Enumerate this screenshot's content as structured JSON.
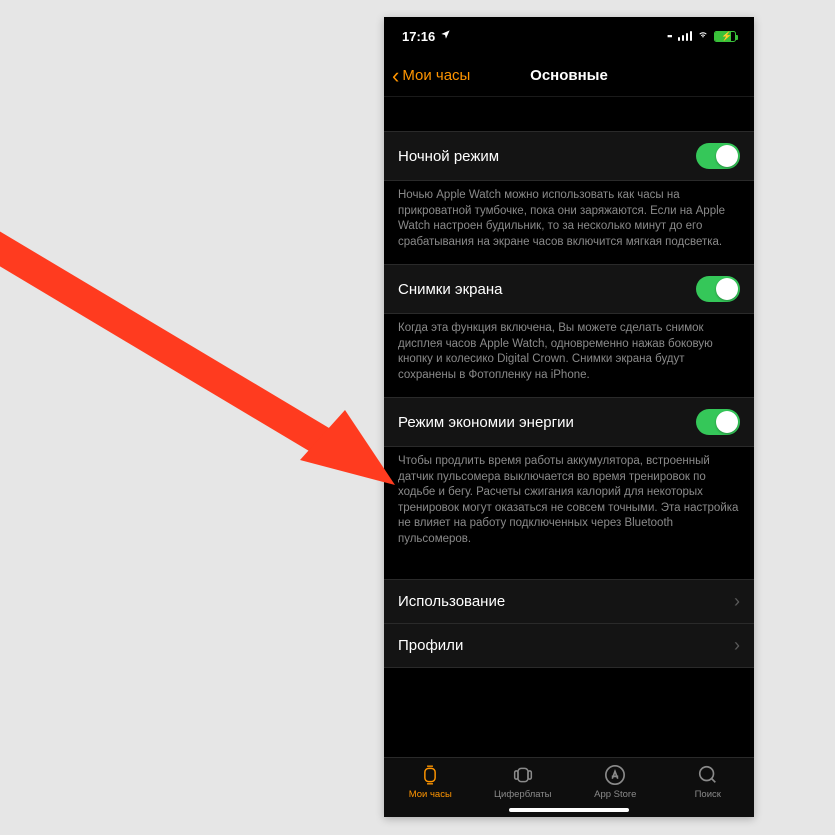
{
  "status": {
    "time": "17:16"
  },
  "nav": {
    "back": "Мои часы",
    "title": "Основные"
  },
  "rows": {
    "night": {
      "label": "Ночной режим",
      "desc": "Ночью Apple Watch можно использовать как часы на прикроватной тумбочке, пока они заряжаются. Если на Apple Watch настроен будильник, то за несколько минут до его срабатывания на экране часов включится мягкая подсветка."
    },
    "screenshots": {
      "label": "Снимки экрана",
      "desc": "Когда эта функция включена, Вы можете сделать снимок дисплея часов Apple Watch, одновременно нажав боковую кнопку и колесико Digital Crown. Снимки экрана будут сохранены в Фотопленку на iPhone."
    },
    "power": {
      "label": "Режим экономии энергии",
      "desc": "Чтобы продлить время работы аккумулятора, встроенный датчик пульсомера выключается во время тренировок по ходьбе и бегу. Расчеты сжигания калорий для некоторых тренировок могут оказаться не совсем точными. Эта настройка не влияет на работу подключенных через Bluetooth пульсомеров."
    },
    "usage": {
      "label": "Использование"
    },
    "profiles": {
      "label": "Профили"
    }
  },
  "tabs": {
    "watch": "Мои часы",
    "faces": "Циферблаты",
    "store": "App Store",
    "search": "Поиск"
  }
}
